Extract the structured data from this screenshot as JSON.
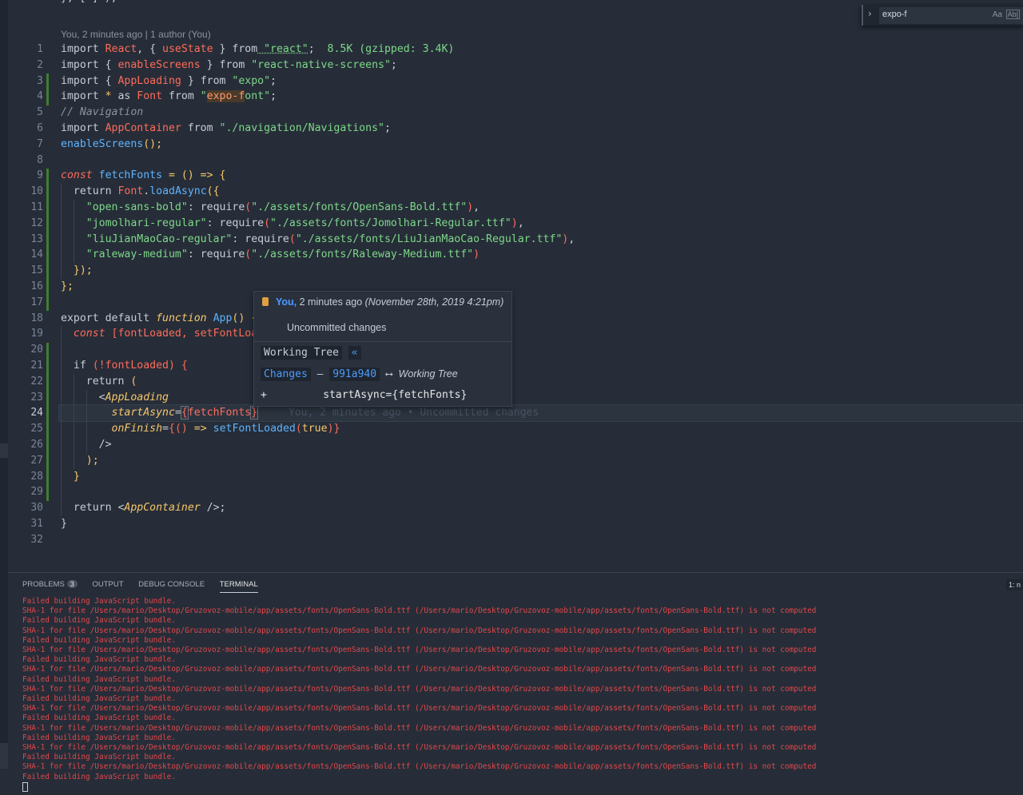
{
  "top_fragment": "}, [ ] );",
  "blame_header": "You, 2 minutes ago | 1 author (You)",
  "find": {
    "query": "expo-f",
    "match_case": "Aa",
    "match_word": "Ab|"
  },
  "line_numbers": [
    "1",
    "2",
    "3",
    "4",
    "5",
    "6",
    "7",
    "8",
    "9",
    "10",
    "11",
    "12",
    "13",
    "14",
    "15",
    "16",
    "17",
    "18",
    "19",
    "20",
    "21",
    "22",
    "23",
    "24",
    "25",
    "26",
    "27",
    "28",
    "29",
    "30",
    "31",
    "32"
  ],
  "code": {
    "l1": [
      "import",
      " React",
      ", { ",
      "useState",
      " } ",
      "from",
      " \"react\"",
      ";",
      "  8.5K (gzipped: 3.4K)"
    ],
    "l2": [
      "import",
      " { ",
      "enableScreens",
      " } ",
      "from",
      " \"react-native-screens\"",
      ";"
    ],
    "l3": [
      "import",
      " { ",
      "AppLoading",
      " } ",
      "from",
      " \"expo\"",
      ";"
    ],
    "l4": [
      "import",
      " * ",
      "as",
      " Font ",
      "from",
      " \"",
      "expo-f",
      "ont\"",
      ";"
    ],
    "l5": [
      "// Navigation"
    ],
    "l6": [
      "import",
      " AppContainer ",
      "from",
      " \"./navigation/Navigations\"",
      ";"
    ],
    "l7": [
      "enableScreens",
      "();"
    ],
    "l9": [
      "const",
      " fetchFonts ",
      "= () => {"
    ],
    "l10": [
      "return",
      " Font",
      ".",
      "loadAsync",
      "({"
    ],
    "l11": [
      "\"open-sans-bold\"",
      ": ",
      "require",
      "(",
      "\"./assets/fonts/OpenSans-Bold.ttf\"",
      ")",
      ","
    ],
    "l12": [
      "\"jomolhari-regular\"",
      ": ",
      "require",
      "(",
      "\"./assets/fonts/Jomolhari-Regular.ttf\"",
      ")",
      ","
    ],
    "l13": [
      "\"liuJianMaoCao-regular\"",
      ": ",
      "require",
      "(",
      "\"./assets/fonts/LiuJianMaoCao-Regular.ttf\"",
      ")",
      ","
    ],
    "l14": [
      "\"raleway-medium\"",
      ": ",
      "require",
      "(",
      "\"./assets/fonts/Raleway-Medium.ttf\"",
      ")"
    ],
    "l15": [
      "});"
    ],
    "l16": [
      "};"
    ],
    "l18": [
      "export default ",
      "function",
      " App",
      "() {"
    ],
    "l19": [
      "const",
      " [fontLoaded, setFontLoa"
    ],
    "l21": [
      "if",
      " (!fontLoaded) {"
    ],
    "l22": [
      "return",
      " ("
    ],
    "l23": [
      "<",
      "AppLoading"
    ],
    "l24": [
      "startAsync",
      "=",
      "{",
      "fetchFonts",
      "}"
    ],
    "l25": [
      "onFinish",
      "=",
      "{",
      "()",
      " => ",
      "setFontLoaded",
      "(",
      "true",
      ")",
      "}"
    ],
    "l26": [
      "/>"
    ],
    "l27": [
      ");"
    ],
    "l28": [
      "}"
    ],
    "l30": [
      "return",
      " <",
      "AppContainer",
      " />;"
    ],
    "l31": [
      "}"
    ]
  },
  "inline_blame": "You, 2 minutes ago • Uncommitted changes",
  "hover": {
    "author": "You,",
    "time": " 2 minutes ago ",
    "date": " (November 28th, 2019 4:21pm)",
    "message": "Uncommitted changes",
    "working_tree": "Working Tree",
    "back": "«",
    "changes": "Changes",
    "dash": "—",
    "sha": "991a940",
    "arrow": "⟷",
    "target": "Working Tree",
    "diff_plus": "+",
    "diff_line": "startAsync={fetchFonts}"
  },
  "panel": {
    "tabs": [
      "PROBLEMS",
      "OUTPUT",
      "DEBUG CONSOLE",
      "TERMINAL"
    ],
    "problems_count": "3",
    "terminal_select": "1: n",
    "lines": [
      "Failed building JavaScript bundle.",
      "SHA-1 for file /Users/mario/Desktop/Gruzovoz-mobile/app/assets/fonts/OpenSans-Bold.ttf (/Users/mario/Desktop/Gruzovoz-mobile/app/assets/fonts/OpenSans-Bold.ttf) is not computed",
      "Failed building JavaScript bundle.",
      "SHA-1 for file /Users/mario/Desktop/Gruzovoz-mobile/app/assets/fonts/OpenSans-Bold.ttf (/Users/mario/Desktop/Gruzovoz-mobile/app/assets/fonts/OpenSans-Bold.ttf) is not computed",
      "Failed building JavaScript bundle.",
      "SHA-1 for file /Users/mario/Desktop/Gruzovoz-mobile/app/assets/fonts/OpenSans-Bold.ttf (/Users/mario/Desktop/Gruzovoz-mobile/app/assets/fonts/OpenSans-Bold.ttf) is not computed",
      "Failed building JavaScript bundle.",
      "SHA-1 for file /Users/mario/Desktop/Gruzovoz-mobile/app/assets/fonts/OpenSans-Bold.ttf (/Users/mario/Desktop/Gruzovoz-mobile/app/assets/fonts/OpenSans-Bold.ttf) is not computed",
      "Failed building JavaScript bundle.",
      "SHA-1 for file /Users/mario/Desktop/Gruzovoz-mobile/app/assets/fonts/OpenSans-Bold.ttf (/Users/mario/Desktop/Gruzovoz-mobile/app/assets/fonts/OpenSans-Bold.ttf) is not computed",
      "Failed building JavaScript bundle.",
      "SHA-1 for file /Users/mario/Desktop/Gruzovoz-mobile/app/assets/fonts/OpenSans-Bold.ttf (/Users/mario/Desktop/Gruzovoz-mobile/app/assets/fonts/OpenSans-Bold.ttf) is not computed",
      "Failed building JavaScript bundle.",
      "SHA-1 for file /Users/mario/Desktop/Gruzovoz-mobile/app/assets/fonts/OpenSans-Bold.ttf (/Users/mario/Desktop/Gruzovoz-mobile/app/assets/fonts/OpenSans-Bold.ttf) is not computed",
      "Failed building JavaScript bundle.",
      "SHA-1 for file /Users/mario/Desktop/Gruzovoz-mobile/app/assets/fonts/OpenSans-Bold.ttf (/Users/mario/Desktop/Gruzovoz-mobile/app/assets/fonts/OpenSans-Bold.ttf) is not computed",
      "Failed building JavaScript bundle.",
      "SHA-1 for file /Users/mario/Desktop/Gruzovoz-mobile/app/assets/fonts/OpenSans-Bold.ttf (/Users/mario/Desktop/Gruzovoz-mobile/app/assets/fonts/OpenSans-Bold.ttf) is not computed",
      "Failed building JavaScript bundle."
    ]
  },
  "colors": {
    "background": "#262d38",
    "keyword": "#c7cdd6",
    "identifier": "#ff6b5a",
    "string": "#7ed88a",
    "function": "#5fb3ff",
    "jsx": "#f7c66b",
    "error": "#e2474a",
    "accent": "#4d9bff"
  }
}
